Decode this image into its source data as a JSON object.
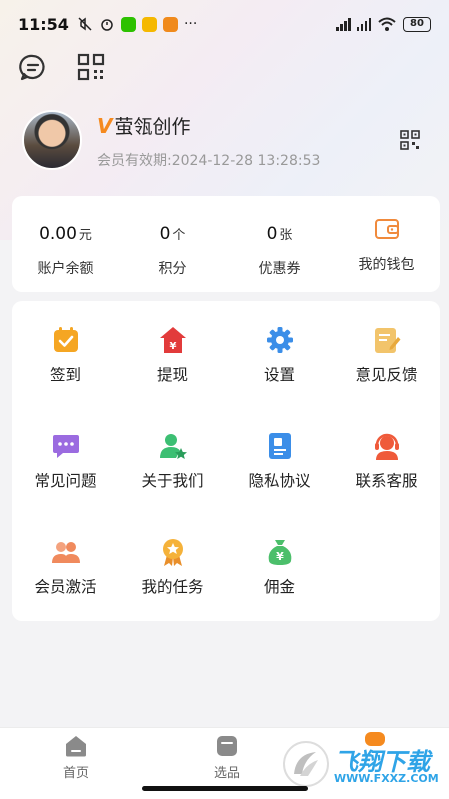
{
  "status_bar": {
    "time": "11:54",
    "battery": "80"
  },
  "profile": {
    "vip_mark": "V",
    "username": "萤瓴创作",
    "expiry": "会员有效期:2024-12-28 13:28:53"
  },
  "stats": [
    {
      "value": "0.00",
      "unit": "元",
      "label": "账户余额"
    },
    {
      "value": "0",
      "unit": "个",
      "label": "积分"
    },
    {
      "value": "0",
      "unit": "张",
      "label": "优惠券"
    }
  ],
  "wallet": {
    "label": "我的钱包",
    "icon": "wallet-icon"
  },
  "menu": [
    {
      "label": "签到",
      "icon": "checkin-icon",
      "color": "#f5a623"
    },
    {
      "label": "提现",
      "icon": "withdraw-icon",
      "color": "#e23b3b"
    },
    {
      "label": "设置",
      "icon": "gear-icon",
      "color": "#3b8ee8"
    },
    {
      "label": "意见反馈",
      "icon": "feedback-icon",
      "color": "#f2c46b"
    },
    {
      "label": "常见问题",
      "icon": "faq-icon",
      "color": "#9b6be0"
    },
    {
      "label": "关于我们",
      "icon": "about-icon",
      "color": "#3cbf73"
    },
    {
      "label": "隐私协议",
      "icon": "privacy-icon",
      "color": "#3b8ee8"
    },
    {
      "label": "联系客服",
      "icon": "customer-service-icon",
      "color": "#ef5a3a"
    },
    {
      "label": "会员激活",
      "icon": "member-activate-icon",
      "color": "#f08a5d"
    },
    {
      "label": "我的任务",
      "icon": "task-icon",
      "color": "#f5b23a"
    },
    {
      "label": "佣金",
      "icon": "commission-icon",
      "color": "#4cbf6b"
    }
  ],
  "nav": [
    {
      "label": "首页",
      "icon": "home-icon"
    },
    {
      "label": "选品",
      "icon": "select-products-icon"
    }
  ],
  "watermark": {
    "title": "飞翔下载",
    "url": "WWW.FXXZ.COM"
  }
}
